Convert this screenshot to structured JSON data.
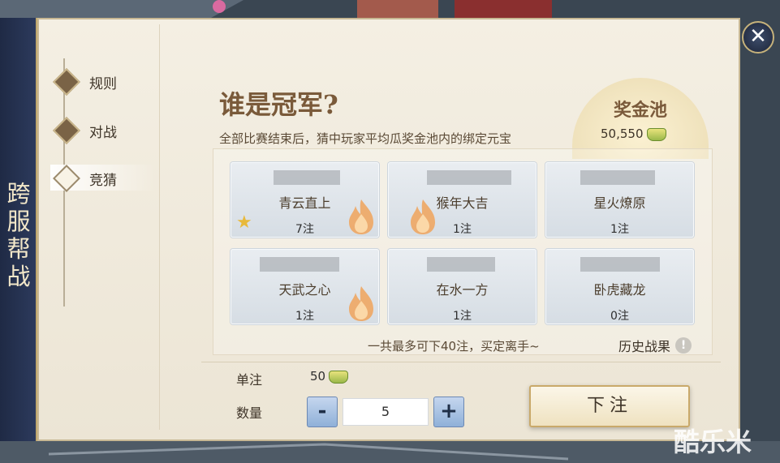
{
  "side_banner": {
    "title": "跨服帮战"
  },
  "close_glyph": "✕",
  "nav": {
    "items": [
      {
        "label": "规则",
        "active": false
      },
      {
        "label": "对战",
        "active": false
      },
      {
        "label": "竞猜",
        "active": true
      }
    ]
  },
  "header": {
    "title": "谁是冠军?",
    "subtitle": "全部比赛结束后，猜中玩家平均瓜奖金池内的绑定元宝"
  },
  "prize_pool": {
    "title": "奖金池",
    "value": "50,550",
    "currency_icon": "gold-ingot-icon"
  },
  "teams": [
    {
      "name": "青云直上",
      "bets": "7注",
      "hot": true,
      "starred": true
    },
    {
      "name": "猴年大吉",
      "bets": "1注",
      "hot": true,
      "starred": false
    },
    {
      "name": "星火燎原",
      "bets": "1注",
      "hot": false,
      "starred": false
    },
    {
      "name": "天武之心",
      "bets": "1注",
      "hot": true,
      "starred": false
    },
    {
      "name": "在水一方",
      "bets": "1注",
      "hot": false,
      "starred": false
    },
    {
      "name": "卧虎藏龙",
      "bets": "0注",
      "hot": false,
      "starred": false
    }
  ],
  "limit_text": "一共最多可下40注，买定离手~",
  "history_label": "历史战果",
  "info_glyph": "!",
  "bet_form": {
    "single_label": "单注",
    "single_value": "50",
    "quantity_label": "数量",
    "minus": "-",
    "plus": "+",
    "quantity_value": "5",
    "submit_label": "下注"
  },
  "watermark": "酷乐米",
  "colors": {
    "accent_brown": "#7a5a3a",
    "rail_navy": "#1f2a45",
    "card_blue": "#d6dde4",
    "flame_orange": "#f0a35a"
  }
}
